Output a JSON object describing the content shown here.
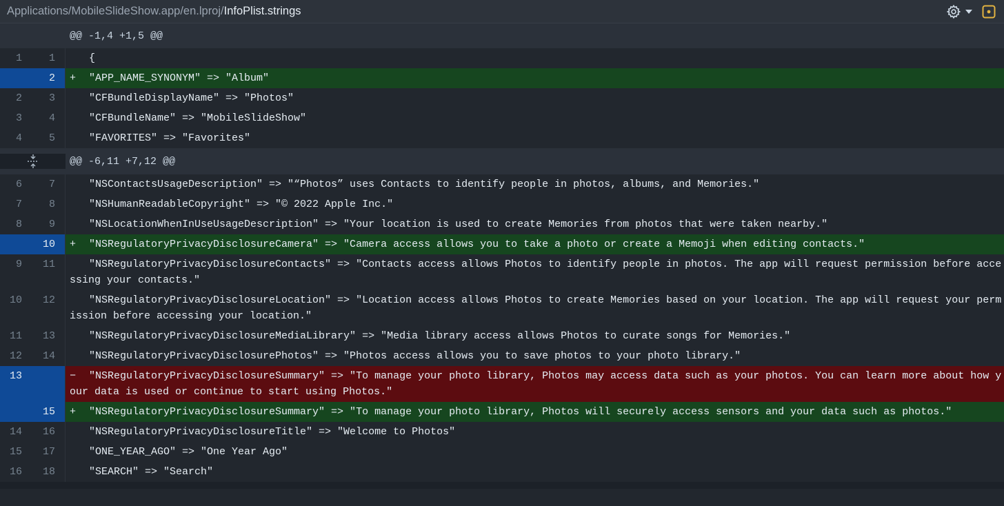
{
  "header": {
    "path_prefix": "Applications/MobileSlideShow.app/en.lproj/",
    "path_file": "InfoPlist.strings",
    "settings_icon": "gear-icon",
    "dropdown_icon": "caret-down-icon",
    "view_icon": "view-file-icon",
    "accent": "#e3b341"
  },
  "colors": {
    "added_bg": "#16461f",
    "removed_bg": "#5c0c10",
    "line_num_highlight": "#0f4a97"
  },
  "hunks": [
    {
      "header": "@@ -1,4 +1,5 @@",
      "lines": [
        {
          "type": "normal",
          "old": "1",
          "new": "1",
          "marker": "",
          "text": "{"
        },
        {
          "type": "added",
          "old": "",
          "new": "2",
          "marker": "+",
          "text": "\"APP_NAME_SYNONYM\" => \"Album\""
        },
        {
          "type": "normal",
          "old": "2",
          "new": "3",
          "marker": "",
          "text": "\"CFBundleDisplayName\" => \"Photos\""
        },
        {
          "type": "normal",
          "old": "3",
          "new": "4",
          "marker": "",
          "text": "\"CFBundleName\" => \"MobileSlideShow\""
        },
        {
          "type": "normal",
          "old": "4",
          "new": "5",
          "marker": "",
          "text": "\"FAVORITES\" => \"Favorites\""
        }
      ]
    },
    {
      "header": "@@ -6,11 +7,12 @@",
      "expand_icon": "expand-icon",
      "lines": [
        {
          "type": "normal",
          "old": "6",
          "new": "7",
          "marker": "",
          "text": "\"NSContactsUsageDescription\" => \"“Photos” uses Contacts to identify people in photos, albums, and Memories.\""
        },
        {
          "type": "normal",
          "old": "7",
          "new": "8",
          "marker": "",
          "text": "\"NSHumanReadableCopyright\" => \"© 2022 Apple Inc.\""
        },
        {
          "type": "normal",
          "old": "8",
          "new": "9",
          "marker": "",
          "text": "\"NSLocationWhenInUseUsageDescription\" => \"Your location is used to create Memories from photos that were taken nearby.\""
        },
        {
          "type": "added",
          "old": "",
          "new": "10",
          "marker": "+",
          "text": "\"NSRegulatoryPrivacyDisclosureCamera\" => \"Camera access allows you to take a photo or create a Memoji when editing contacts.\""
        },
        {
          "type": "normal",
          "old": "9",
          "new": "11",
          "marker": "",
          "text": "\"NSRegulatoryPrivacyDisclosureContacts\" => \"Contacts access allows Photos to identify people in photos. The app will request permission before accessing your contacts.\""
        },
        {
          "type": "normal",
          "old": "10",
          "new": "12",
          "marker": "",
          "text": "\"NSRegulatoryPrivacyDisclosureLocation\" => \"Location access allows Photos to create Memories based on your location. The app will request your permission before accessing your location.\""
        },
        {
          "type": "normal",
          "old": "11",
          "new": "13",
          "marker": "",
          "text": "\"NSRegulatoryPrivacyDisclosureMediaLibrary\" => \"Media library access allows Photos to curate songs for Memories.\""
        },
        {
          "type": "normal",
          "old": "12",
          "new": "14",
          "marker": "",
          "text": "\"NSRegulatoryPrivacyDisclosurePhotos\" => \"Photos access allows you to save photos to your photo library.\""
        },
        {
          "type": "removed",
          "old": "13",
          "new": "",
          "marker": "−",
          "text": "\"NSRegulatoryPrivacyDisclosureSummary\" => \"To manage your photo library, Photos may access data such as your photos. You can learn more about how your data is used or continue to start using Photos.\""
        },
        {
          "type": "added",
          "old": "",
          "new": "15",
          "marker": "+",
          "text": "\"NSRegulatoryPrivacyDisclosureSummary\" => \"To manage your photo library, Photos will securely access sensors and your data such as photos.\""
        },
        {
          "type": "normal",
          "old": "14",
          "new": "16",
          "marker": "",
          "text": "\"NSRegulatoryPrivacyDisclosureTitle\" => \"Welcome to Photos\""
        },
        {
          "type": "normal",
          "old": "15",
          "new": "17",
          "marker": "",
          "text": "\"ONE_YEAR_AGO\" => \"One Year Ago\""
        },
        {
          "type": "normal",
          "old": "16",
          "new": "18",
          "marker": "",
          "text": "\"SEARCH\" => \"Search\""
        }
      ]
    }
  ]
}
